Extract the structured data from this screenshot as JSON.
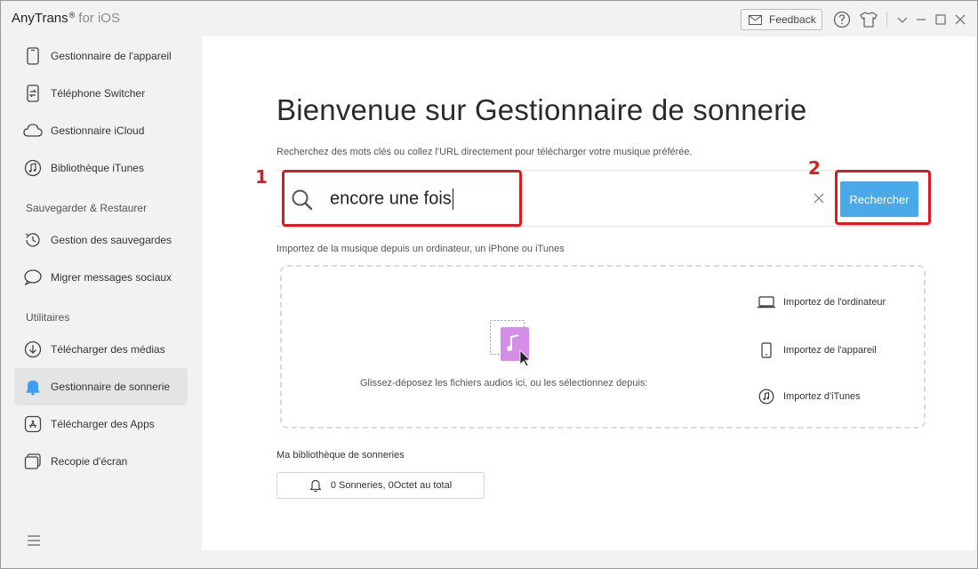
{
  "window": {
    "app_name": "AnyTrans",
    "app_mark": "®",
    "app_suffix": "for iOS",
    "feedback_label": "Feedback"
  },
  "sidebar": {
    "items_top": [
      {
        "label": "Gestionnaire de l'appareil",
        "icon": "phone-icon"
      },
      {
        "label": "Téléphone Switcher",
        "icon": "phone-switch-icon"
      },
      {
        "label": "Gestionnaire iCloud",
        "icon": "cloud-icon"
      },
      {
        "label": "Bibliothèque iTunes",
        "icon": "music-library-icon"
      }
    ],
    "section_backup": "Sauvegarder & Restaurer",
    "items_backup": [
      {
        "label": "Gestion des sauvegardes",
        "icon": "history-icon"
      },
      {
        "label": "Migrer messages sociaux",
        "icon": "chat-icon"
      }
    ],
    "section_utils": "Utilitaires",
    "items_utils": [
      {
        "label": "Télécharger des médias",
        "icon": "download-icon"
      },
      {
        "label": "Gestionnaire de sonnerie",
        "icon": "bell-icon"
      },
      {
        "label": "Télécharger des Apps",
        "icon": "app-store-icon"
      },
      {
        "label": "Recopie d'écran",
        "icon": "screen-mirror-icon"
      }
    ],
    "active_item": "Gestionnaire de sonnerie",
    "accent_color": "#3d9df0"
  },
  "main": {
    "title": "Bienvenue sur Gestionnaire de sonnerie",
    "subtitle": "Recherchez des mots clés ou collez l'URL directement pour télécharger votre musique préférée.",
    "search": {
      "value": "encore une fois",
      "button_label": "Rechercher"
    },
    "annotations": {
      "step1": "1",
      "step2": "2",
      "color": "#e0191f"
    },
    "import_label": "Importez de la musique depuis un ordinateur, un iPhone ou iTunes",
    "drop_text": "Glissez-déposez les fichiers audios ici, ou les sélectionnez depuis:",
    "import_options": [
      {
        "label": "Importez de l'ordinateur",
        "icon": "laptop-icon"
      },
      {
        "label": "Importez de l'appareil",
        "icon": "phone-icon"
      },
      {
        "label": "Importez d'iTunes",
        "icon": "itunes-icon"
      }
    ],
    "library_label": "Ma bibliothèque de sonneries",
    "library_summary": "0 Sonneries, 0Octet au total"
  }
}
